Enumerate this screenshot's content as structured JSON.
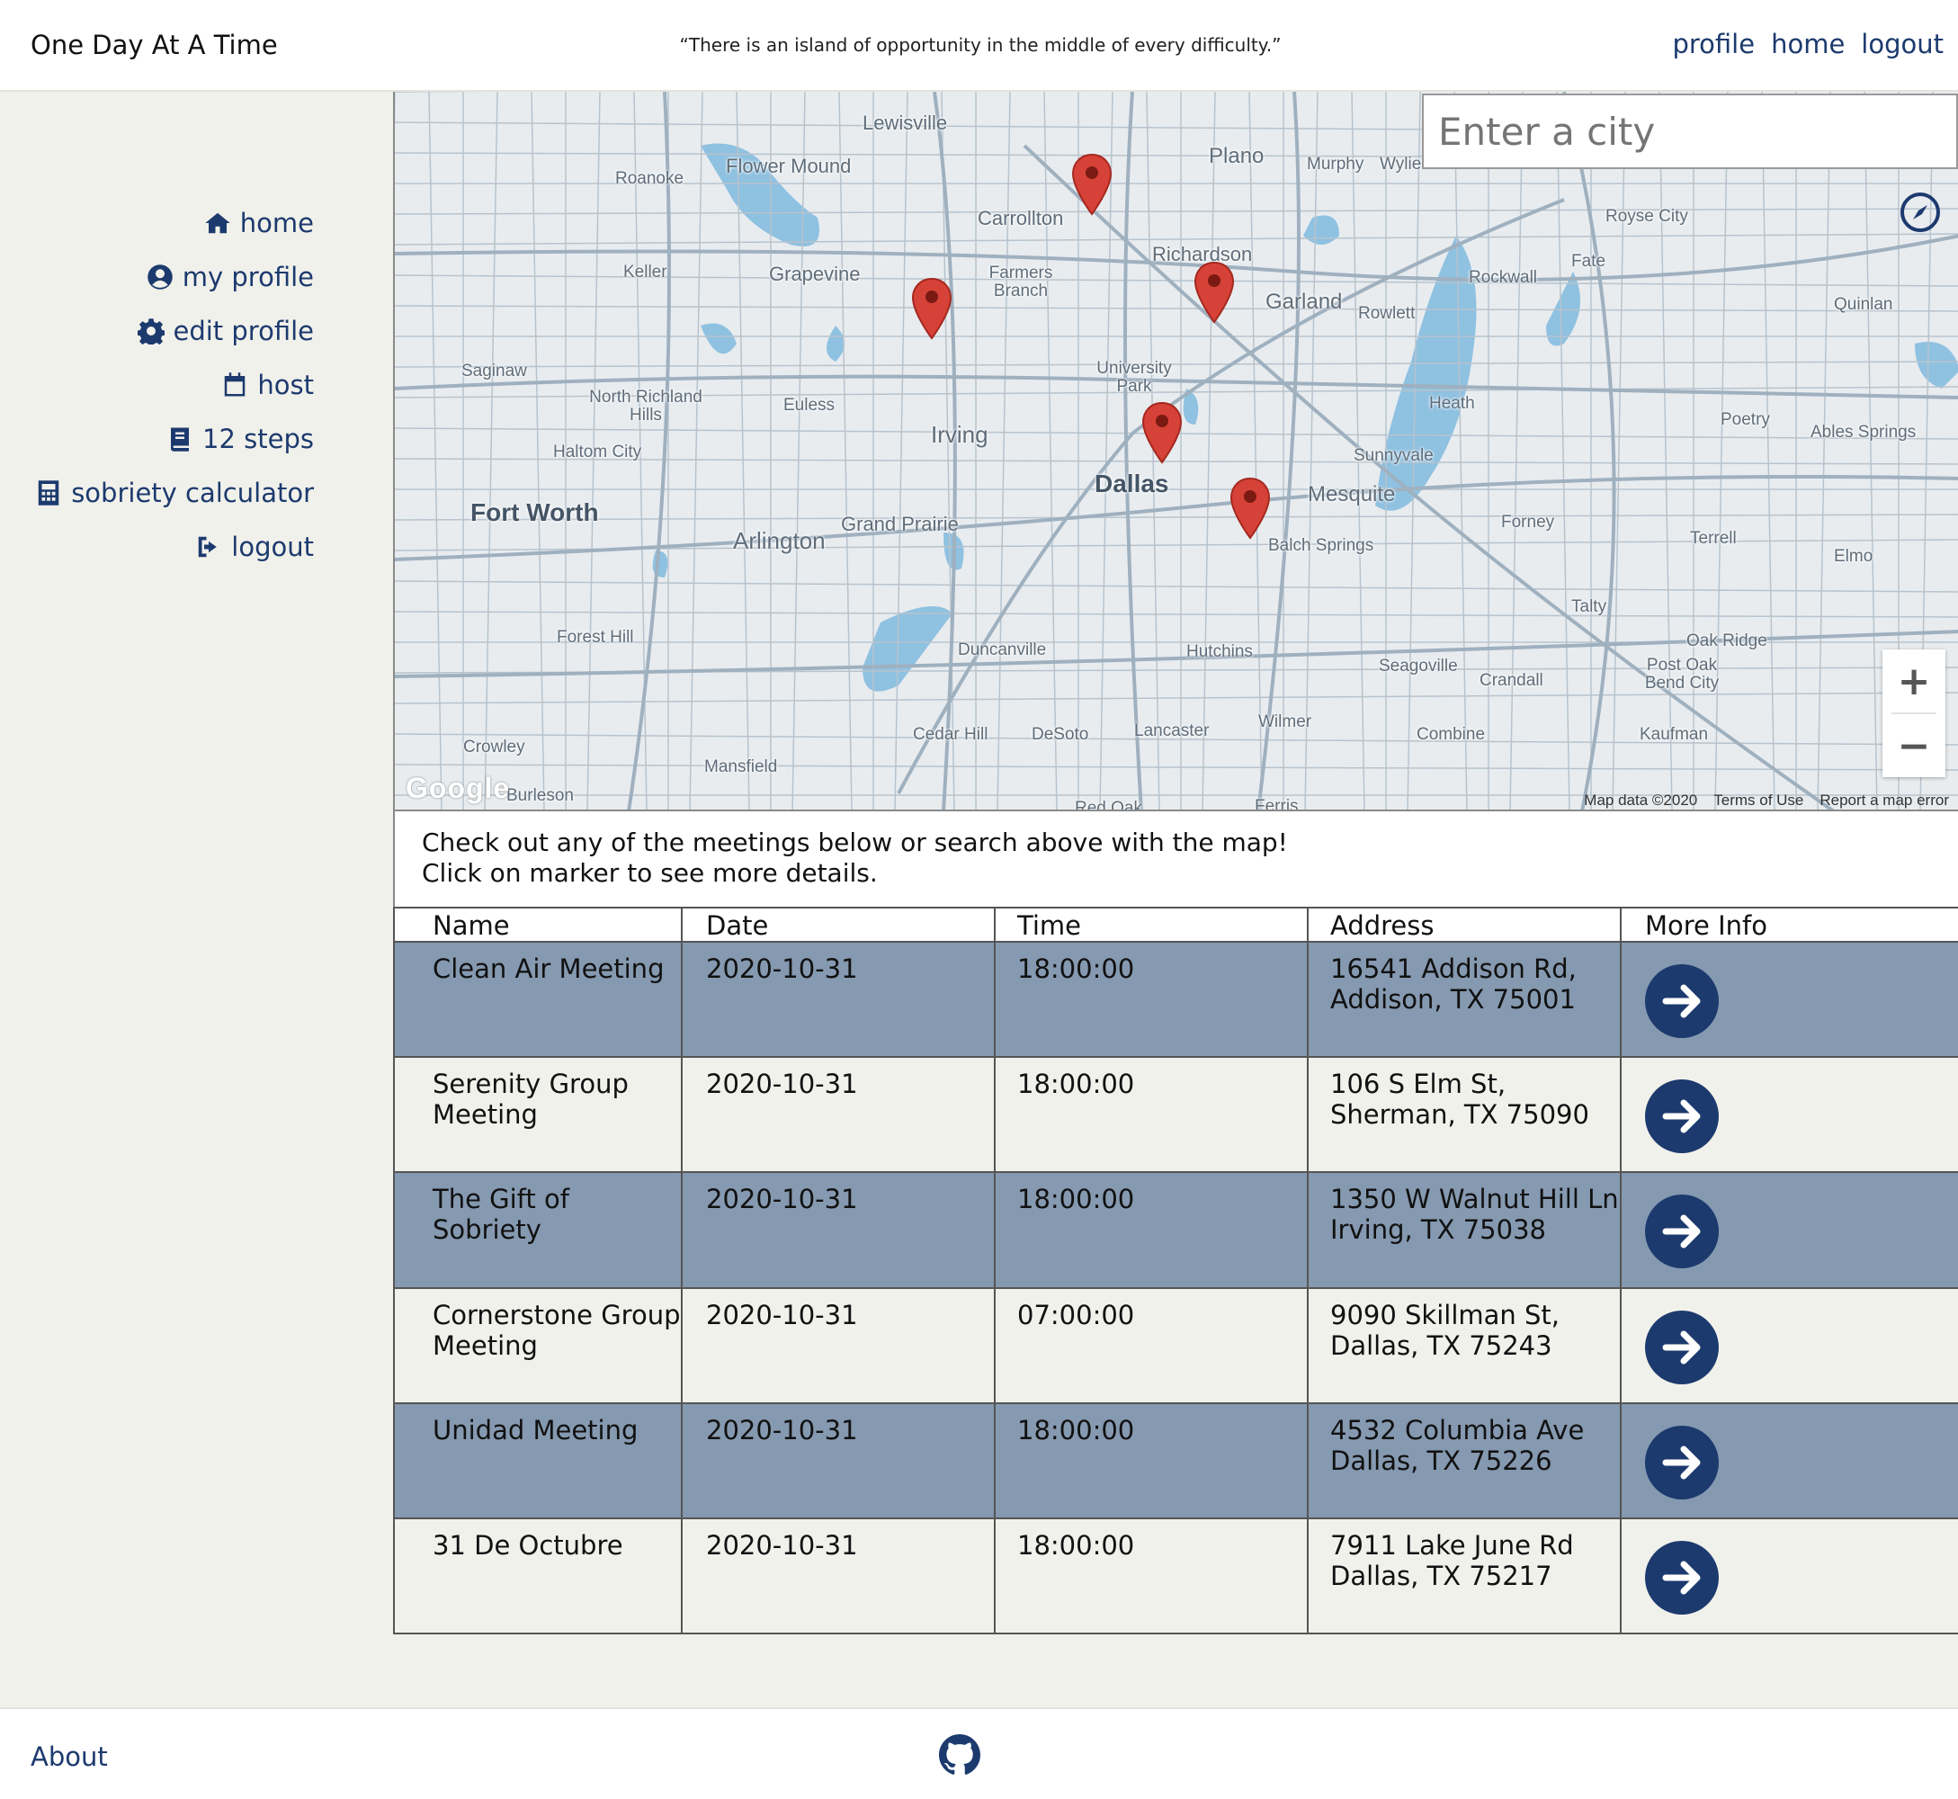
{
  "header": {
    "brand": "One Day At A Time",
    "quote": "“There is an island of opportunity in the middle of every difficulty.”",
    "nav": [
      "profile",
      "home",
      "logout"
    ]
  },
  "sidebar": {
    "items": [
      {
        "label": "home",
        "icon": "home-icon"
      },
      {
        "label": "my profile",
        "icon": "user-circle-icon"
      },
      {
        "label": "edit profile",
        "icon": "gear-icon"
      },
      {
        "label": "host",
        "icon": "calendar-icon"
      },
      {
        "label": "12 steps",
        "icon": "book-icon"
      },
      {
        "label": "sobriety calculator",
        "icon": "calculator-icon"
      },
      {
        "label": "logout",
        "icon": "sign-out-icon"
      }
    ]
  },
  "map": {
    "search_placeholder": "Enter a city",
    "zoom_in": "+",
    "zoom_out": "−",
    "logo": "Google",
    "footer": [
      "Map data ©2020",
      "Terms of Use",
      "Report a map error"
    ],
    "cities": [
      {
        "name": "Lewisville"
      },
      {
        "name": "Plano"
      },
      {
        "name": "Murphy"
      },
      {
        "name": "Wylie"
      },
      {
        "name": "Flower Mound"
      },
      {
        "name": "Roanoke"
      },
      {
        "name": "Carrollton"
      },
      {
        "name": "Royse City"
      },
      {
        "name": "Keller"
      },
      {
        "name": "Grapevine"
      },
      {
        "name": "Farmers Branch"
      },
      {
        "name": "Richardson"
      },
      {
        "name": "Garland"
      },
      {
        "name": "Rowlett"
      },
      {
        "name": "Rockwall"
      },
      {
        "name": "Fate"
      },
      {
        "name": "Quinlan"
      },
      {
        "name": "Saginaw"
      },
      {
        "name": "North Richland Hills"
      },
      {
        "name": "Euless"
      },
      {
        "name": "University Park"
      },
      {
        "name": "Heath"
      },
      {
        "name": "Poetry"
      },
      {
        "name": "Ables Springs"
      },
      {
        "name": "Haltom City"
      },
      {
        "name": "Irving"
      },
      {
        "name": "Sunnyvale"
      },
      {
        "name": "Dallas"
      },
      {
        "name": "Mesquite"
      },
      {
        "name": "Fort Worth"
      },
      {
        "name": "Arlington"
      },
      {
        "name": "Grand Prairie"
      },
      {
        "name": "Forney"
      },
      {
        "name": "Terrell"
      },
      {
        "name": "Balch Springs"
      },
      {
        "name": "Elmo"
      },
      {
        "name": "Talty"
      },
      {
        "name": "Forest Hill"
      },
      {
        "name": "Duncanville"
      },
      {
        "name": "Hutchins"
      },
      {
        "name": "Oak Ridge"
      },
      {
        "name": "Seagoville"
      },
      {
        "name": "Crandall"
      },
      {
        "name": "Post Oak Bend City"
      },
      {
        "name": "Cedar Hill"
      },
      {
        "name": "DeSoto"
      },
      {
        "name": "Lancaster"
      },
      {
        "name": "Wilmer"
      },
      {
        "name": "Combine"
      },
      {
        "name": "Kaufman"
      },
      {
        "name": "Crowley"
      },
      {
        "name": "Mansfield"
      },
      {
        "name": "Burleson"
      },
      {
        "name": "Red Oak"
      },
      {
        "name": "Ferris"
      }
    ],
    "marker_color": "#d64237"
  },
  "intro": {
    "line1": "Check out any of the meetings below or search above with the map!",
    "line2": "Click on marker to see more details."
  },
  "table": {
    "headers": [
      "Name",
      "Date",
      "Time",
      "Address",
      "More Info"
    ],
    "rows": [
      {
        "name": "Clean Air Meeting",
        "date": "2020-10-31",
        "time": "18:00:00",
        "address": "16541 Addison Rd, Addison, TX 75001"
      },
      {
        "name": "Serenity Group Meeting",
        "date": "2020-10-31",
        "time": "18:00:00",
        "address": "106 S Elm St, Sherman, TX 75090"
      },
      {
        "name": "The Gift of Sobriety",
        "date": "2020-10-31",
        "time": "18:00:00",
        "address": "1350 W Walnut Hill Ln Irving, TX 75038"
      },
      {
        "name": "Cornerstone Group Meeting",
        "date": "2020-10-31",
        "time": "07:00:00",
        "address": "9090 Skillman St, Dallas, TX 75243"
      },
      {
        "name": "Unidad Meeting",
        "date": "2020-10-31",
        "time": "18:00:00",
        "address": "4532 Columbia Ave Dallas, TX 75226"
      },
      {
        "name": "31 De Octubre",
        "date": "2020-10-31",
        "time": "18:00:00",
        "address": "7911 Lake June Rd Dallas, TX 75217"
      }
    ]
  },
  "footer": {
    "about": "About",
    "github_icon": "github-icon"
  },
  "colors": {
    "accent": "#1c3a6e",
    "row_dark": "#8599b0",
    "row_light": "#f1f1eb",
    "sidebar_bg": "#f1f1eb"
  }
}
